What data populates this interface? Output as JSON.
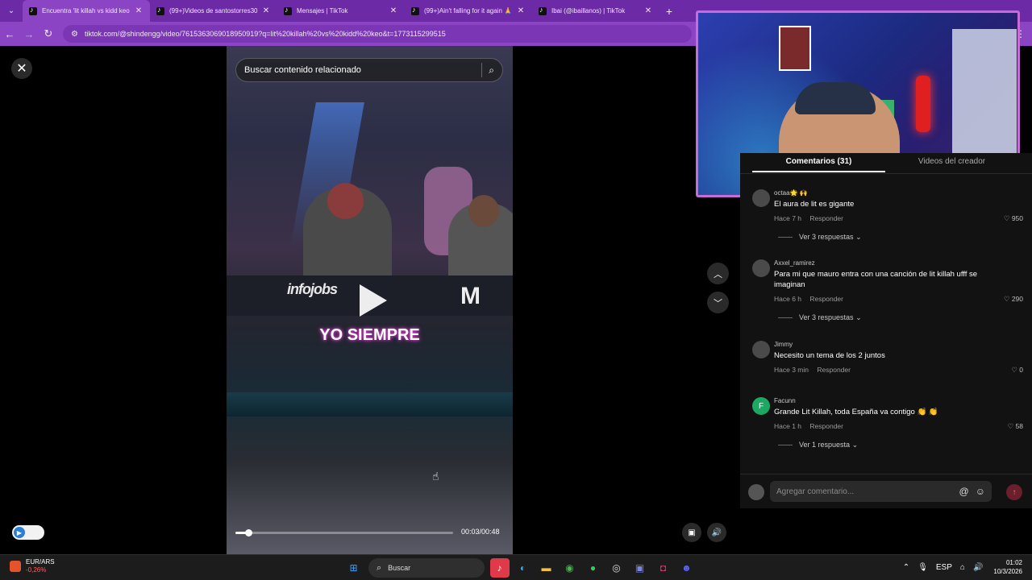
{
  "browser": {
    "tabs": [
      {
        "title": "Encuentra 'lit killah vs kidd keo",
        "active": true
      },
      {
        "title": "(99+)Videos de santostorres30",
        "active": false
      },
      {
        "title": "Mensajes | TikTok",
        "active": false
      },
      {
        "title": "(99+)Ain't falling for it again 🙏",
        "active": false
      },
      {
        "title": "Ibai (@ibaillanos) | TikTok",
        "active": false
      }
    ],
    "new_tab": "+",
    "url": "tiktok.com/@shindengg/video/7615363069018950919?q=lit%20killah%20vs%20kidd%20keo&t=1773115299515"
  },
  "video": {
    "search_placeholder": "Buscar contenido relacionado",
    "desk_logo": "infojobs",
    "subtitle": "YO SIEMPRE",
    "time": "00:03/00:48",
    "progress": 0.06,
    "is_paused": true
  },
  "comments_panel": {
    "tabs": [
      "Comentarios (31)",
      "Videos del creador"
    ],
    "comments": [
      {
        "user": "octaa🌟 🙌",
        "text": "El aura de lit es gigante",
        "time": "Hace 7 h",
        "reply": "Responder",
        "likes": "950",
        "replies": "Ver 3 respuestas",
        "avatar": ""
      },
      {
        "user": "Axxel_ramirez",
        "text": "Para mi que mauro entra con una canción de lit killah ufff se imaginan",
        "time": "Hace 6 h",
        "reply": "Responder",
        "likes": "290",
        "replies": "Ver 3 respuestas",
        "avatar": ""
      },
      {
        "user": "Jimmy",
        "text": "Necesito un tema de los 2 juntos",
        "time": "Hace 3 min",
        "reply": "Responder",
        "likes": "0",
        "replies": "",
        "avatar": ""
      },
      {
        "user": "Facunn",
        "text": "Grande Lit Killah, toda España va contigo 👏 👏",
        "time": "Hace 1 h",
        "reply": "Responder",
        "likes": "58",
        "replies": "Ver 1 respuesta",
        "avatar": "F"
      }
    ],
    "add_comment_placeholder": "Agregar comentario..."
  },
  "taskbar": {
    "ticker_symbol": "EUR/ARS",
    "ticker_change": "-0,26%",
    "search_label": "Buscar",
    "lang": "ESP",
    "time": "01:02",
    "date": "10/3/2026"
  },
  "colors": {
    "chrome_tab_bar": "#6d2aa6",
    "chrome_toolbar": "#8a44c4",
    "webcam_border": "#c86ad8",
    "subtitle_glow": "#d33cc8"
  }
}
